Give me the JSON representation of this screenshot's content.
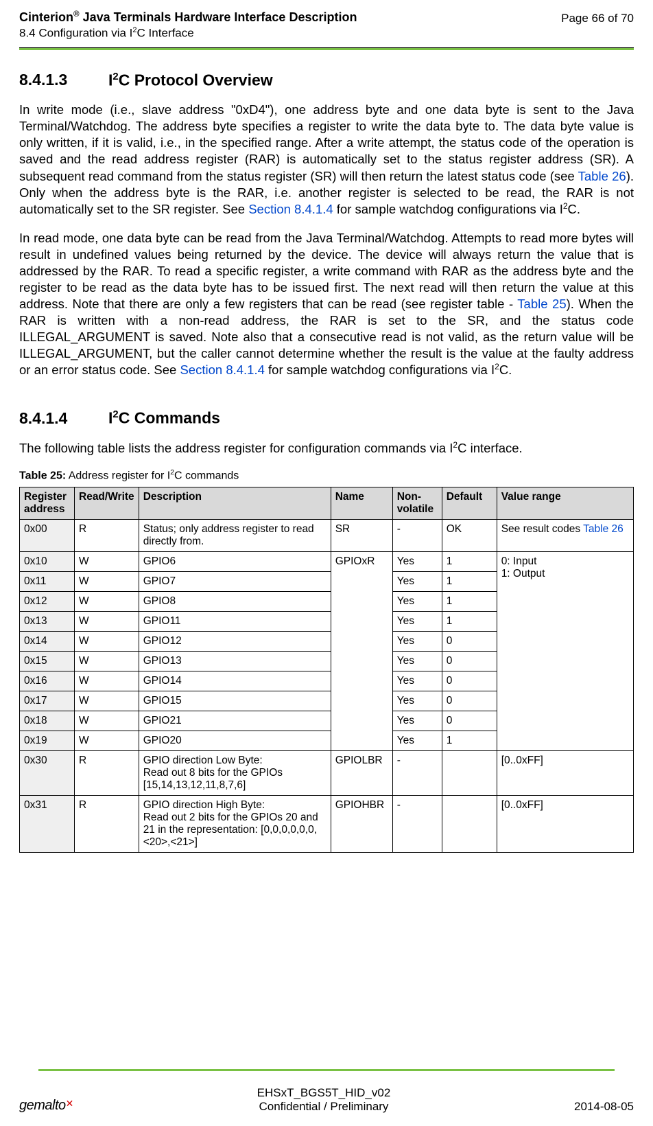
{
  "header": {
    "product": "Cinterion",
    "title_suffix": " Java Terminals Hardware Interface Description",
    "subtitle_prefix": "8.4 Configuration via I",
    "subtitle_suffix": "C Interface",
    "page_info": "Page 66 of 70"
  },
  "section1": {
    "num": "8.4.1.3",
    "title_prefix": "I",
    "title_suffix": "C Protocol Overview",
    "para1_a": "In write mode (i.e., slave address \"0xD4\"), one address byte and one data byte is sent to the Java Terminal/Watchdog. The address byte specifies a register to write the data byte to. The data byte value is only written, if it is valid, i.e., in the specified range. After a write attempt, the status code of the operation is saved and the read address register (RAR) is automatically set to the status register address (SR). A subsequent read command from the status register (SR) will then return the latest status code (see ",
    "para1_link1": "Table 26",
    "para1_b": "). Only when the address byte is the RAR, i.e. another register is selected to be read, the RAR is not automatically set to the SR register. See ",
    "para1_link2": "Section 8.4.1.4",
    "para1_c": " for sample watchdog configurations via I",
    "para1_d": "C.",
    "para2_a": "In read mode, one data byte can be read from the Java Terminal/Watchdog. Attempts to read more bytes will result in undefined values being returned by the device. The device will always return the value that is addressed by the RAR. To read a specific register, a write command with RAR as the address byte and the register to be read as the data byte has to be issued first. The next read will then return the value at this address. Note that there are only a few registers that can be read (see register table - ",
    "para2_link1": "Table 25",
    "para2_b": "). When the RAR is written with a non-read address, the RAR is set to the SR, and the status code ILLEGAL_ARGUMENT is saved. Note also that a consecutive read is not valid, as the return value will be ILLEGAL_ARGUMENT, but the caller cannot determine whether the result is the value at the faulty address or an error status code. See ",
    "para2_link2": "Section 8.4.1.4",
    "para2_c": " for sample watchdog configurations via I",
    "para2_d": "C."
  },
  "section2": {
    "num": "8.4.1.4",
    "title_prefix": "I",
    "title_suffix": "C Commands",
    "intro_a": "The following table lists the address register for configuration commands via I",
    "intro_b": "C interface."
  },
  "table": {
    "caption_label": "Table 25:",
    "caption_text_a": "  Address register for I",
    "caption_text_b": "C commands",
    "headers": {
      "reg": "Register address",
      "rw": "Read/Write",
      "desc": "Description",
      "name": "Name",
      "nv": "Non-volatile",
      "def": "Default",
      "range": "Value range"
    },
    "rows": {
      "r0": {
        "reg": "0x00",
        "rw": "R",
        "desc": "Status; only address register to read directly from.",
        "name": "SR",
        "nv": "-",
        "def": "OK",
        "range_a": "See result codes ",
        "range_link": "Table 26"
      },
      "r1": {
        "reg": "0x10",
        "rw": "W",
        "desc": "GPIO6",
        "nv": "Yes",
        "def": "1"
      },
      "r2": {
        "reg": "0x11",
        "rw": "W",
        "desc": "GPIO7",
        "nv": "Yes",
        "def": "1"
      },
      "r3": {
        "reg": "0x12",
        "rw": "W",
        "desc": "GPIO8",
        "nv": "Yes",
        "def": "1"
      },
      "r4": {
        "reg": "0x13",
        "rw": "W",
        "desc": "GPIO11",
        "nv": "Yes",
        "def": "1"
      },
      "r5": {
        "reg": "0x14",
        "rw": "W",
        "desc": "GPIO12",
        "nv": "Yes",
        "def": "0"
      },
      "r6": {
        "reg": "0x15",
        "rw": "W",
        "desc": "GPIO13",
        "nv": "Yes",
        "def": "0"
      },
      "r7": {
        "reg": "0x16",
        "rw": "W",
        "desc": "GPIO14",
        "nv": "Yes",
        "def": "0"
      },
      "r8": {
        "reg": "0x17",
        "rw": "W",
        "desc": "GPIO15",
        "nv": "Yes",
        "def": "0"
      },
      "r9": {
        "reg": "0x18",
        "rw": "W",
        "desc": "GPIO21",
        "nv": "Yes",
        "def": "0"
      },
      "r10": {
        "reg": "0x19",
        "rw": "W",
        "desc": "GPIO20",
        "nv": "Yes",
        "def": "1"
      },
      "gpio_name": "GPIOxR",
      "gpio_range": "0: Input\n1: Output",
      "r11": {
        "reg": "0x30",
        "rw": "R",
        "desc": "GPIO direction Low Byte:\nRead out 8 bits for the GPIOs [15,14,13,12,11,8,7,6]",
        "name": "GPIOLBR",
        "nv": "-",
        "def": "",
        "range": "[0..0xFF]"
      },
      "r12": {
        "reg": "0x31",
        "rw": "R",
        "desc": "GPIO direction High Byte:\nRead out 2 bits for the GPIOs 20 and 21 in the representation: [0,0,0,0,0,0,<20>,<21>]",
        "name": "GPIOHBR",
        "nv": "-",
        "def": "",
        "range": "[0..0xFF]"
      }
    }
  },
  "footer": {
    "logo": "gemalto",
    "doc_id": "EHSxT_BGS5T_HID_v02",
    "confidential": "Confidential / Preliminary",
    "date": "2014-08-05"
  }
}
